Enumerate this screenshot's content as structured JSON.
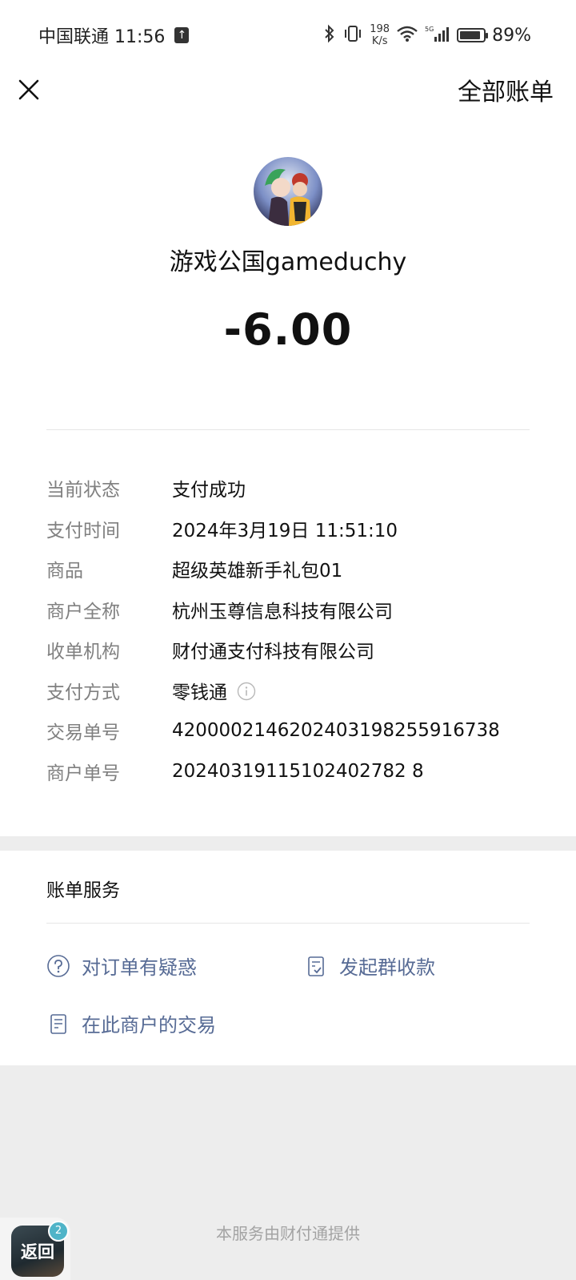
{
  "status_bar": {
    "carrier_time": "中国联通 11:56",
    "speed_value": "198",
    "speed_unit": "K/s",
    "network": "5G",
    "battery": "89%",
    "battery_level": 0.89
  },
  "nav": {
    "all_bills": "全部账单"
  },
  "merchant": {
    "name": "游戏公国gameduchy",
    "amount": "-6.00"
  },
  "details": [
    {
      "label": "当前状态",
      "value": "支付成功"
    },
    {
      "label": "支付时间",
      "value": "2024年3月19日 11:51:10"
    },
    {
      "label": "商品",
      "value": "超级英雄新手礼包01"
    },
    {
      "label": "商户全称",
      "value": "杭州玉尊信息科技有限公司"
    },
    {
      "label": "收单机构",
      "value": "财付通支付科技有限公司"
    },
    {
      "label": "支付方式",
      "value": "零钱通"
    },
    {
      "label": "交易单号",
      "value": "4200002146202403198255916738"
    },
    {
      "label": "商户单号",
      "value": "20240319115102402782 8"
    }
  ],
  "services": {
    "title": "账单服务",
    "doubt": "对订单有疑惑",
    "group_collect": "发起群收款",
    "merchant_trades": "在此商户的交易"
  },
  "footer": {
    "provider": "本服务由财付通提供",
    "back_label": "返回",
    "back_badge": "2"
  },
  "colors": {
    "link": "#576b95",
    "label": "#808080",
    "background": "#ededed"
  }
}
